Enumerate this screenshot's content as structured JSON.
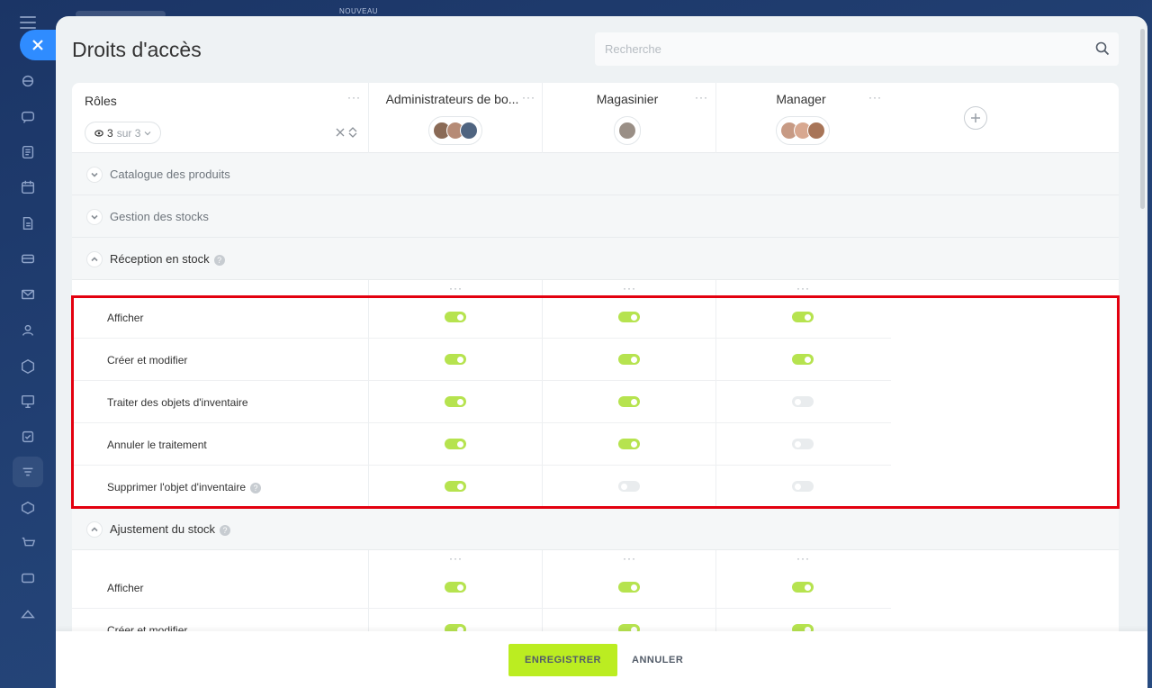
{
  "background": {
    "behind_tag": "NOUVEAU"
  },
  "panel": {
    "title": "Droits d'accès",
    "search": {
      "placeholder": "Recherche"
    }
  },
  "table": {
    "roles_label": "Rôles",
    "filter": {
      "count": "3",
      "suffix": "sur 3"
    },
    "columns": [
      {
        "label": "Administrateurs de bo...",
        "avatar_count": 3
      },
      {
        "label": "Magasinier",
        "avatar_count": 1
      },
      {
        "label": "Manager",
        "avatar_count": 3
      }
    ],
    "sections": [
      {
        "label": "Catalogue des produits",
        "expanded": false
      },
      {
        "label": "Gestion des stocks",
        "expanded": false
      },
      {
        "label": "Réception en stock",
        "expanded": true,
        "help": "?",
        "rows": [
          {
            "label": "Afficher",
            "values": [
              true,
              true,
              true
            ]
          },
          {
            "label": "Créer et modifier",
            "values": [
              true,
              true,
              true
            ]
          },
          {
            "label": "Traiter des objets d'inventaire",
            "values": [
              true,
              true,
              false
            ]
          },
          {
            "label": "Annuler le traitement",
            "values": [
              true,
              true,
              false
            ]
          },
          {
            "label": "Supprimer l'objet d'inventaire",
            "values": [
              true,
              false,
              false
            ],
            "help": "?"
          }
        ]
      },
      {
        "label": "Ajustement du stock",
        "expanded": true,
        "help": "?",
        "rows": [
          {
            "label": "Afficher",
            "values": [
              true,
              true,
              true
            ]
          },
          {
            "label": "Créer et modifier",
            "values": [
              true,
              true,
              true
            ]
          }
        ]
      }
    ]
  },
  "footer": {
    "save_label": "ENREGISTRER",
    "cancel_label": "ANNULER"
  },
  "colors": {
    "accent_green": "#bbed21",
    "toggle_on": "#b6e34f",
    "highlight": "#e3000f",
    "close_blue": "#2f8cff"
  }
}
